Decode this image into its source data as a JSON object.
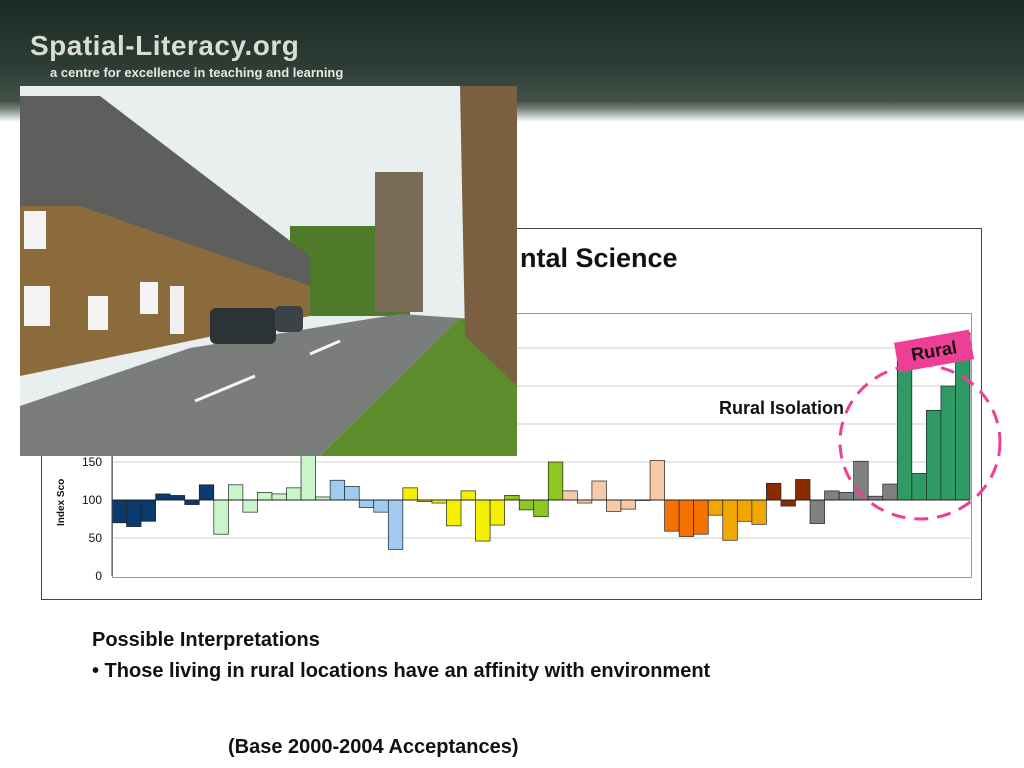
{
  "header": {
    "logo_text": "Spatial-Literacy.org",
    "tagline": "a centre for excellence in teaching and learning"
  },
  "chart_data": {
    "type": "bar",
    "title": "ntal Science",
    "ylabel": "Index Sco",
    "ylim": [
      0,
      350
    ],
    "baseline": 100,
    "yticks": [
      0,
      50,
      100,
      150
    ],
    "grid": true,
    "bar_groups": [
      {
        "color": "#0d3a6e",
        "values": [
          70,
          65,
          72,
          108,
          106,
          94,
          120
        ]
      },
      {
        "color": "#c9f5c9",
        "values": [
          55,
          120,
          84,
          110,
          108,
          116,
          160,
          104
        ]
      },
      {
        "color": "#9fcbf0",
        "values": [
          126,
          118,
          90,
          84,
          35
        ]
      },
      {
        "color": "#f5f000",
        "values": [
          116,
          98,
          96,
          66,
          112,
          46,
          67
        ]
      },
      {
        "color": "#8cc820",
        "values": [
          106,
          87,
          78,
          150
        ]
      },
      {
        "color": "#f8c9a5",
        "values": [
          112,
          96,
          125,
          85,
          88,
          100,
          152
        ]
      },
      {
        "color": "#f57200",
        "values": [
          59,
          52,
          55
        ]
      },
      {
        "color": "#f0a800",
        "values": [
          80,
          47,
          72,
          68
        ]
      },
      {
        "color": "#8a2a00",
        "values": [
          122,
          92,
          127
        ]
      },
      {
        "color": "#808080",
        "values": [
          69,
          112,
          110,
          151,
          105,
          121
        ]
      },
      {
        "color": "#2f9a64",
        "values": [
          300,
          135,
          218,
          250,
          320
        ]
      }
    ],
    "annotations": {
      "isolation_label": "Rural Isolation",
      "rural_tag": "Rural"
    }
  },
  "photo": {
    "sky": "#e9eeee",
    "road": "#7b7d7a",
    "stone": "#8b6a3c",
    "grass": "#5c8d2c"
  },
  "text": {
    "interpretations_heading": "Possible Interpretations",
    "interpretation_1": "• Those living in rural locations have an affinity with environment",
    "base_note": "(Base 2000-2004 Acceptances)"
  }
}
